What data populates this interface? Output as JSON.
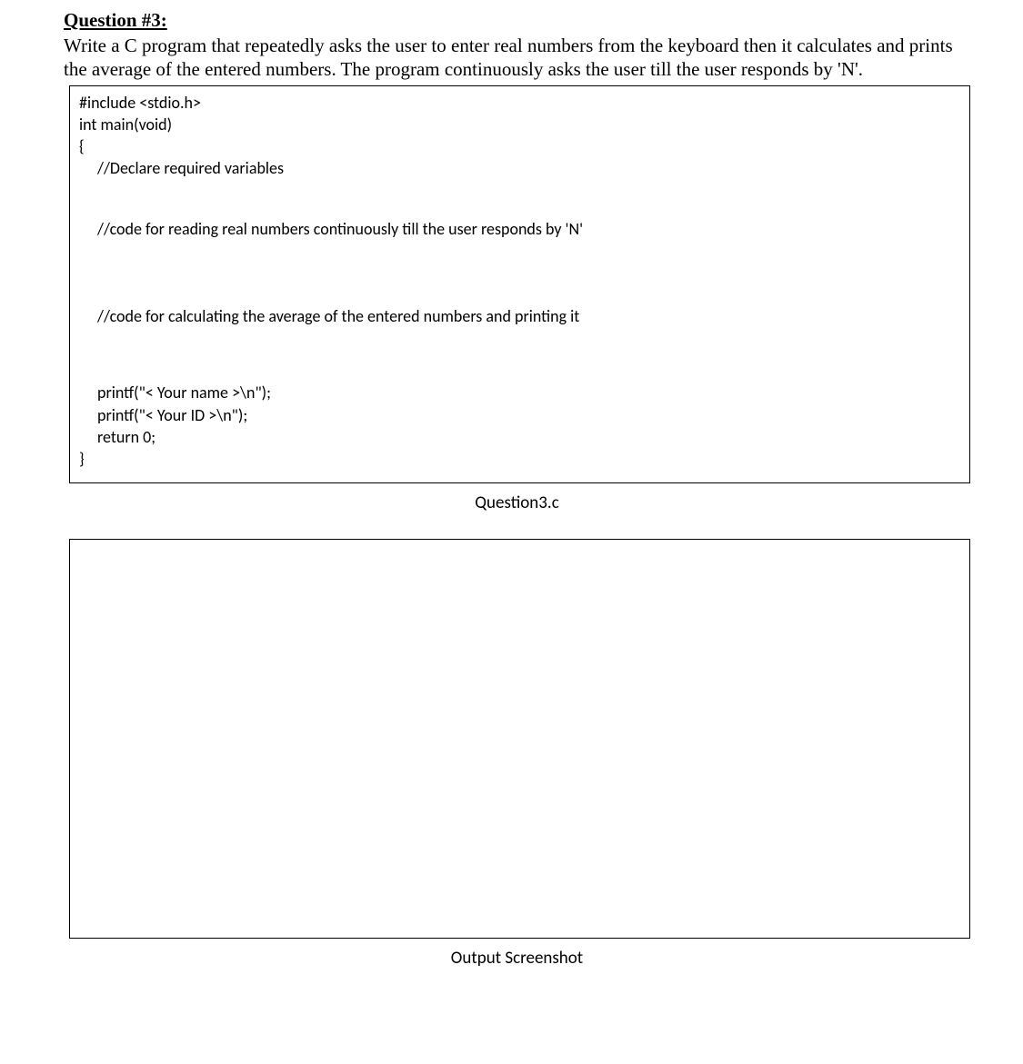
{
  "question": {
    "title": "Question #3:",
    "text": "Write a C program that repeatedly asks the user to enter real numbers from the keyboard then it calculates and prints the average of the entered numbers. The program continuously asks the user till the user responds by 'N'."
  },
  "code": {
    "line1": "#include <stdio.h>",
    "line2": "int main(void)",
    "line3": "{",
    "comment1": "//Declare required variables",
    "comment2": "//code for reading real numbers continuously till the user responds by 'N'",
    "comment3": "//code for calculating the average of the entered numbers and printing it",
    "line_printf1": "printf(\"< Your name >\\n\");",
    "line_printf2": "printf(\"< Your ID >\\n\");",
    "line_return": "return 0;",
    "line_close": "}"
  },
  "captions": {
    "code_caption": "Question3.c",
    "output_caption": "Output Screenshot"
  }
}
